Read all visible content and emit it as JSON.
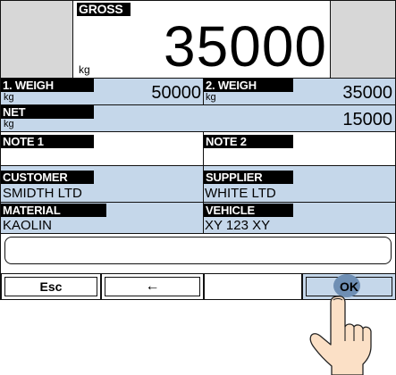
{
  "gross": {
    "label": "GROSS",
    "unit": "kg",
    "value": "35000"
  },
  "weigh1": {
    "label": "1. WEIGH",
    "unit": "kg",
    "value": "50000"
  },
  "weigh2": {
    "label": "2. WEIGH",
    "unit": "kg",
    "value": "35000"
  },
  "net": {
    "label": "NET",
    "unit": "kg",
    "value": "15000"
  },
  "note1": {
    "label": "NOTE 1",
    "value": ""
  },
  "note2": {
    "label": "NOTE 2",
    "value": ""
  },
  "customer": {
    "label": "CUSTOMER",
    "value": "SMIDTH LTD"
  },
  "supplier": {
    "label": "SUPPLIER",
    "value": "WHITE LTD"
  },
  "material": {
    "label": "MATERIAL",
    "value": "KAOLIN"
  },
  "vehicle": {
    "label": "VEHICLE",
    "value": "XY 123 XY"
  },
  "input": {
    "value": ""
  },
  "buttons": {
    "esc": "Esc",
    "back": "←",
    "ok": "OK"
  },
  "colors": {
    "field_blue": "#c5d7ea",
    "panel_gray": "#d7d7d7",
    "ok_highlight": "#6f8fb4",
    "skin": "#fbe0c6"
  }
}
